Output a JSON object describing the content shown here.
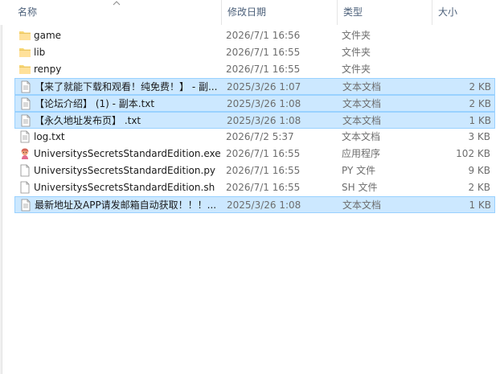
{
  "columns": {
    "name": "名称",
    "date": "修改日期",
    "type": "类型",
    "size": "大小"
  },
  "files": [
    {
      "name": "game",
      "date": "2026/7/1 16:56",
      "type": "文件夹",
      "size": "",
      "icon": "folder-icon",
      "selected": false
    },
    {
      "name": "lib",
      "date": "2026/7/1 16:55",
      "type": "文件夹",
      "size": "",
      "icon": "folder-icon",
      "selected": false
    },
    {
      "name": "renpy",
      "date": "2026/7/1 16:55",
      "type": "文件夹",
      "size": "",
      "icon": "folder-icon",
      "selected": false
    },
    {
      "name": "【来了就能下载和观看！纯免费！】 - 副...",
      "date": "2025/3/26 1:07",
      "type": "文本文档",
      "size": "2 KB",
      "icon": "text-file-icon",
      "selected": true
    },
    {
      "name": "【论坛介绍】 (1) - 副本.txt",
      "date": "2025/3/26 1:08",
      "type": "文本文档",
      "size": "2 KB",
      "icon": "text-file-icon",
      "selected": true
    },
    {
      "name": "【永久地址发布页】 .txt",
      "date": "2025/3/26 1:08",
      "type": "文本文档",
      "size": "1 KB",
      "icon": "text-file-icon",
      "selected": true
    },
    {
      "name": "log.txt",
      "date": "2026/7/2 5:37",
      "type": "文本文档",
      "size": "3 KB",
      "icon": "text-file-icon",
      "selected": false
    },
    {
      "name": "UniversitysSecretsStandardEdition.exe",
      "date": "2026/7/1 16:55",
      "type": "应用程序",
      "size": "102 KB",
      "icon": "exe-icon",
      "selected": false
    },
    {
      "name": "UniversitysSecretsStandardEdition.py",
      "date": "2026/7/1 16:55",
      "type": "PY 文件",
      "size": "9 KB",
      "icon": "blank-file-icon",
      "selected": false
    },
    {
      "name": "UniversitysSecretsStandardEdition.sh",
      "date": "2026/7/1 16:55",
      "type": "SH 文件",
      "size": "2 KB",
      "icon": "blank-file-icon",
      "selected": false
    },
    {
      "name": "最新地址及APP请发邮箱自动获取！！！...",
      "date": "2025/3/26 1:08",
      "type": "文本文档",
      "size": "1 KB",
      "icon": "text-file-icon",
      "selected": true
    }
  ],
  "colors": {
    "selection_bg": "#cce8ff",
    "selection_border": "#99d1ff",
    "header_text": "#4c607a",
    "folder": "#f8d775"
  }
}
